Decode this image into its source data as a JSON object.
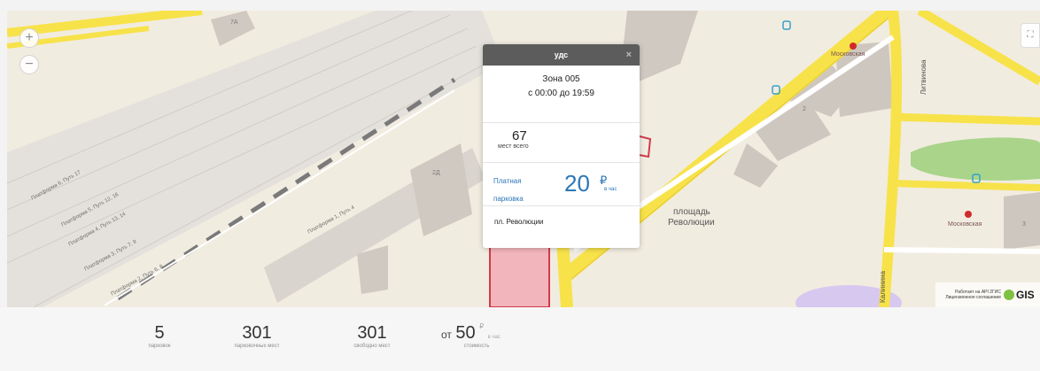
{
  "map": {
    "zoom_in": "+",
    "zoom_out": "−",
    "fullscreen_icon": "⛶",
    "track_labels": [
      "Платформа 6, Путь 17",
      "Платформа 5, Путь 12, 16",
      "Платформа 4, Путь 13, 14",
      "Платформа 3, Путь 7, 9",
      "Платформа 2, Путь 6, 8",
      "Платформа 1, Путь 4"
    ],
    "building_labels": [
      "7А",
      "2Д",
      "2",
      "3"
    ],
    "metro_labels": [
      "Московская",
      "Московская"
    ],
    "square_label_1": "площадь",
    "square_label_2": "Революции",
    "street_label_1": "Литвинова",
    "street_label_2": "Калинина",
    "attribution_text": "Работает на API 2ГИС Лицензионное соглашение",
    "gis_text": "GIS"
  },
  "popup": {
    "title": "удс",
    "close": "×",
    "zone": "Зона 005",
    "hours": "с 00:00 до 19:59",
    "total_places": "67",
    "total_places_label": "мест всего",
    "kind_line1": "Платная",
    "kind_line2": "парковка",
    "price": "20",
    "currency": "₽",
    "per_hour": "в час",
    "address": "пл. Революции"
  },
  "stats": {
    "parkings_value": "5",
    "parkings_label": "парковок",
    "spaces_value": "301",
    "spaces_label": "парковочных мест",
    "free_value": "301",
    "free_label": "свободно мест",
    "cost_prefix": "от",
    "cost_value": "50",
    "cost_currency": "₽",
    "cost_unit": "в час",
    "cost_label": "стоимость"
  },
  "colors": {
    "map_bg": "#f1ece0",
    "road_yellow": "#f7e24a",
    "accent_blue": "#2b77b8",
    "popup_header": "#5c5c5c"
  }
}
